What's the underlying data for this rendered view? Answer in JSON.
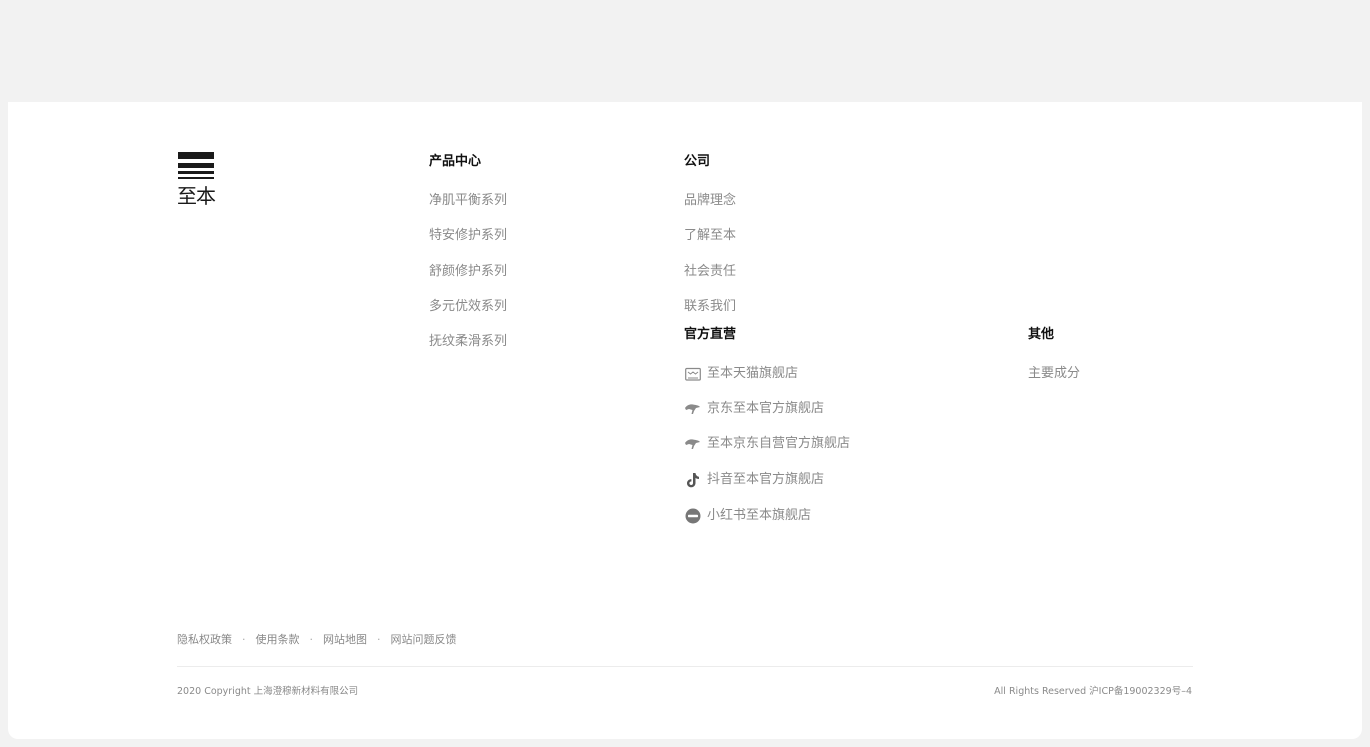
{
  "brand": {
    "logo_text": "至本"
  },
  "products": {
    "title": "产品中心",
    "items": [
      "净肌平衡系列",
      "特安修护系列",
      "舒颜修护系列",
      "多元优效系列",
      "抚纹柔滑系列"
    ]
  },
  "company": {
    "title": "公司",
    "items": [
      "品牌理念",
      "了解至本",
      "社会责任",
      "联系我们"
    ]
  },
  "official_stores": {
    "title": "官方直营",
    "items": [
      {
        "label": "至本天猫旗舰店",
        "icon": "tmall-icon"
      },
      {
        "label": "京东至本官方旗舰店",
        "icon": "jd-icon"
      },
      {
        "label": "至本京东自营官方旗舰店",
        "icon": "jd-icon"
      },
      {
        "label": "抖音至本官方旗舰店",
        "icon": "douyin-icon"
      },
      {
        "label": "小红书至本旗舰店",
        "icon": "xiaohongshu-icon"
      }
    ]
  },
  "other": {
    "title": "其他",
    "items": [
      "主要成分"
    ]
  },
  "legal": {
    "links": [
      "隐私权政策",
      "使用条款",
      "网站地图",
      "网站问题反馈"
    ],
    "separator": "·"
  },
  "footer": {
    "copyright": "2020 Copyright 上海澄穆新材料有限公司",
    "rights": "All Rights Reserved 沪ICP备19002329号–4"
  }
}
